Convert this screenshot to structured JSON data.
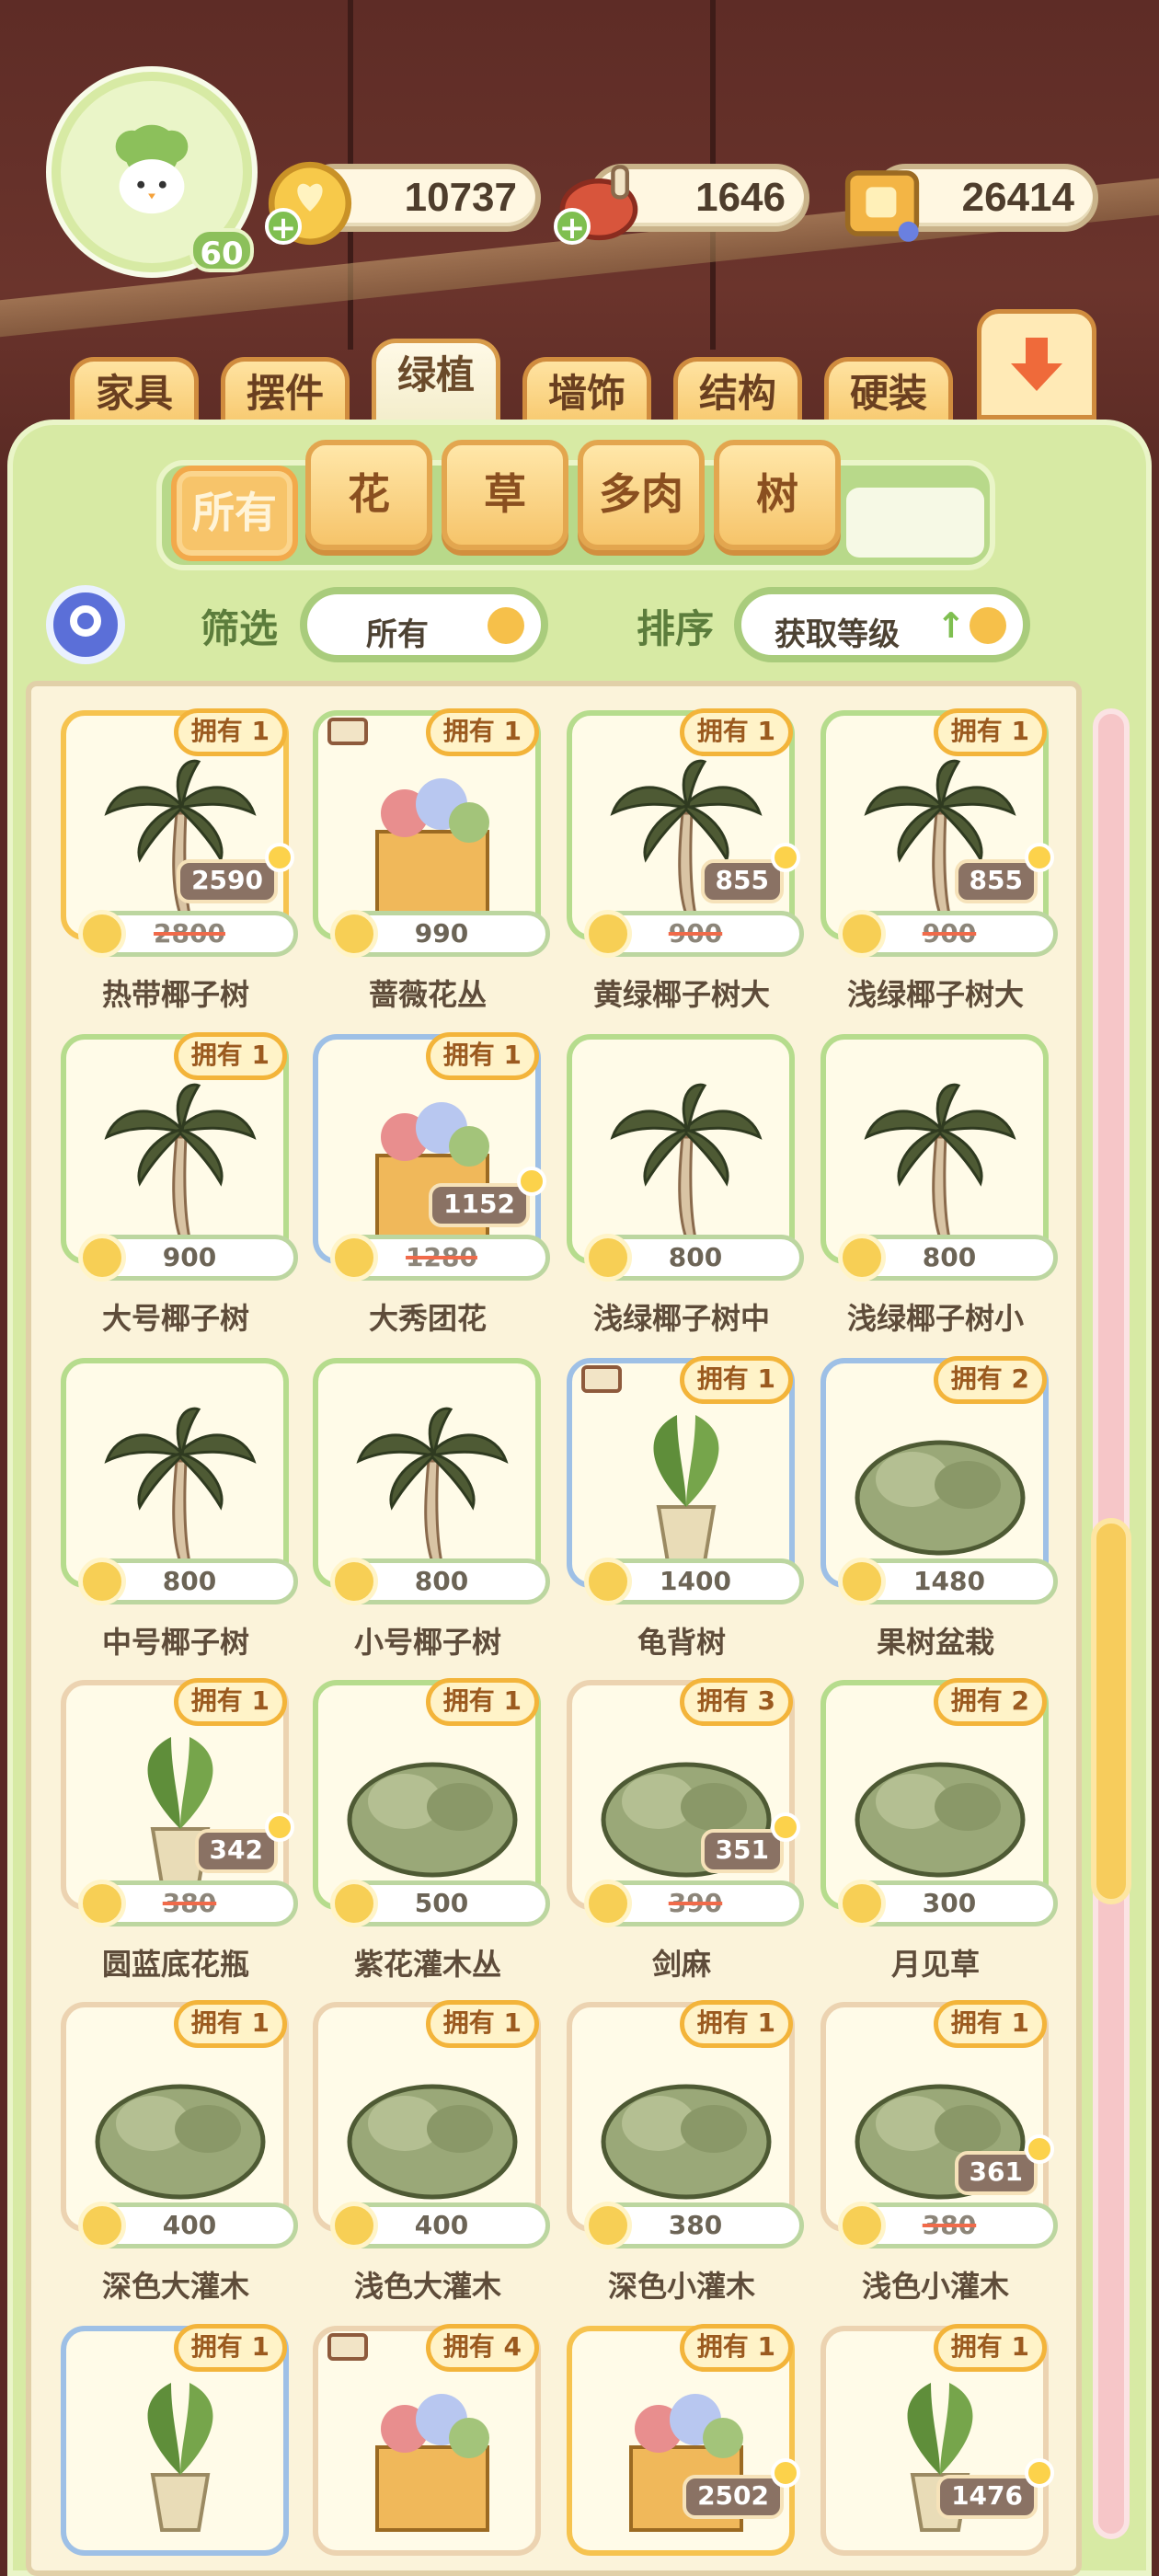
{
  "player": {
    "level": "60"
  },
  "currencies": [
    {
      "name": "coin-icon",
      "value": "10737"
    },
    {
      "name": "meat-icon",
      "value": "1646"
    },
    {
      "name": "book-icon",
      "value": "26414"
    }
  ],
  "tabs": [
    "家具",
    "摆件",
    "绿植",
    "墙饰",
    "结构",
    "硬装"
  ],
  "active_tab": "绿植",
  "subtabs": [
    "所有",
    "花",
    "草",
    "多肉",
    "树"
  ],
  "active_subtab": "所有",
  "filter": {
    "label": "筛选",
    "value": "所有"
  },
  "sort": {
    "label": "排序",
    "value": "获取等级"
  },
  "items": [
    {
      "name": "热带椰子树",
      "owned": "拥有 1",
      "price": "2800",
      "sale": "2590",
      "border": "orange",
      "truck": false
    },
    {
      "name": "蔷薇花丛",
      "owned": "拥有 1",
      "price": "990",
      "sale": "",
      "border": "green",
      "truck": true
    },
    {
      "name": "黄绿椰子树大",
      "owned": "拥有 1",
      "price": "900",
      "sale": "855",
      "border": "green",
      "truck": false
    },
    {
      "name": "浅绿椰子树大",
      "owned": "拥有 1",
      "price": "900",
      "sale": "855",
      "border": "green",
      "truck": false
    },
    {
      "name": "大号椰子树",
      "owned": "拥有 1",
      "price": "900",
      "sale": "",
      "border": "green",
      "truck": false
    },
    {
      "name": "大秀团花",
      "owned": "拥有 1",
      "price": "1280",
      "sale": "1152",
      "border": "blue",
      "truck": false
    },
    {
      "name": "浅绿椰子树中",
      "owned": "",
      "price": "800",
      "sale": "",
      "border": "green",
      "truck": false
    },
    {
      "name": "浅绿椰子树小",
      "owned": "",
      "price": "800",
      "sale": "",
      "border": "green",
      "truck": false
    },
    {
      "name": "中号椰子树",
      "owned": "",
      "price": "800",
      "sale": "",
      "border": "green",
      "truck": false
    },
    {
      "name": "小号椰子树",
      "owned": "",
      "price": "800",
      "sale": "",
      "border": "green",
      "truck": false
    },
    {
      "name": "龟背树",
      "owned": "拥有 1",
      "price": "1400",
      "sale": "",
      "border": "blue",
      "truck": true
    },
    {
      "name": "果树盆栽",
      "owned": "拥有 2",
      "price": "1480",
      "sale": "",
      "border": "blue",
      "truck": false
    },
    {
      "name": "圆蓝底花瓶",
      "owned": "拥有 1",
      "price": "380",
      "sale": "342",
      "border": "peach",
      "truck": false
    },
    {
      "name": "紫花灌木丛",
      "owned": "拥有 1",
      "price": "500",
      "sale": "",
      "border": "green",
      "truck": false
    },
    {
      "name": "剑麻",
      "owned": "拥有 3",
      "price": "390",
      "sale": "351",
      "border": "peach",
      "truck": false
    },
    {
      "name": "月见草",
      "owned": "拥有 2",
      "price": "300",
      "sale": "",
      "border": "green",
      "truck": false
    },
    {
      "name": "深色大灌木",
      "owned": "拥有 1",
      "price": "400",
      "sale": "",
      "border": "peach",
      "truck": false
    },
    {
      "name": "浅色大灌木",
      "owned": "拥有 1",
      "price": "400",
      "sale": "",
      "border": "peach",
      "truck": false
    },
    {
      "name": "深色小灌木",
      "owned": "拥有 1",
      "price": "380",
      "sale": "",
      "border": "peach",
      "truck": false
    },
    {
      "name": "浅色小灌木",
      "owned": "拥有 1",
      "price": "380",
      "sale": "361",
      "border": "peach",
      "truck": false
    },
    {
      "name": "",
      "owned": "拥有 1",
      "price": "",
      "sale": "",
      "border": "blue",
      "truck": false
    },
    {
      "name": "",
      "owned": "拥有 4",
      "price": "",
      "sale": "",
      "border": "peach",
      "truck": true
    },
    {
      "name": "",
      "owned": "拥有 1",
      "price": "",
      "sale": "2502",
      "border": "orange",
      "truck": false
    },
    {
      "name": "",
      "owned": "拥有 1",
      "price": "",
      "sale": "1476",
      "border": "peach",
      "truck": false
    }
  ],
  "colors": {
    "panel": "#d7eaa4",
    "accent": "#f6c34f",
    "grid_bg": "#fbf3da"
  }
}
